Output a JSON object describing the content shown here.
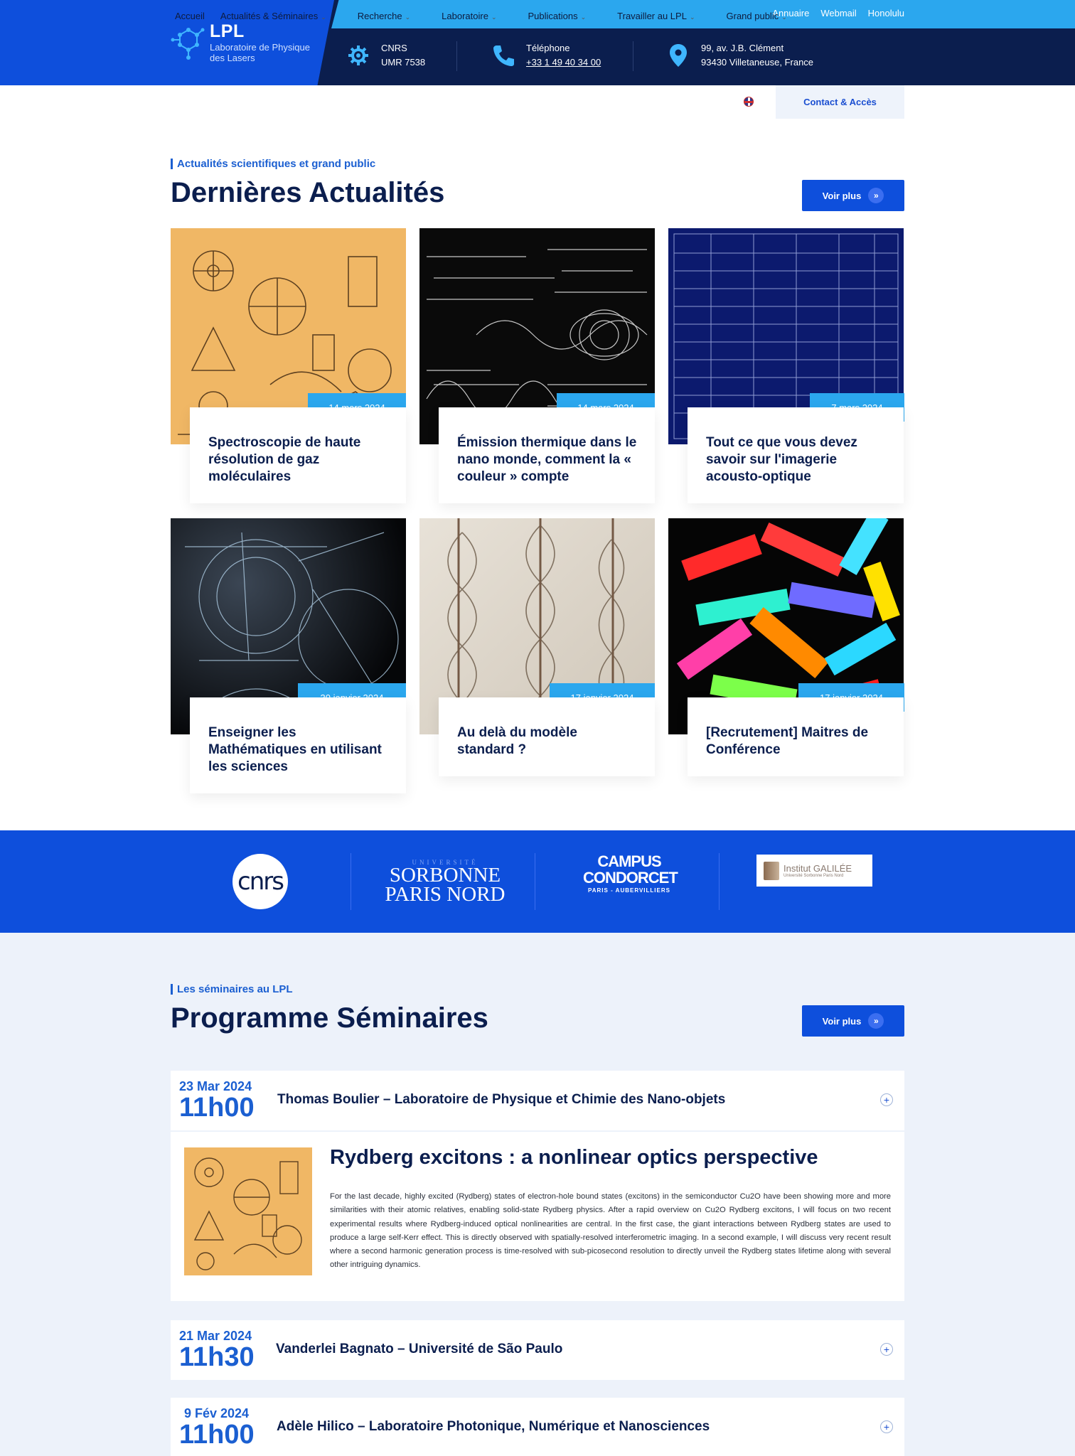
{
  "header": {
    "top_links": [
      "Annuaire",
      "Webmail",
      "Honolulu"
    ],
    "logo_title": "LPL",
    "logo_subtitle": "Laboratoire de Physique des Lasers",
    "info1_line1": "CNRS",
    "info1_line2": "UMR 7538",
    "info2_line1": "Téléphone",
    "info2_line2": "+33 1 49 40 34 00",
    "info3_line1": "99, av. J.B. Clément",
    "info3_line2": "93430 Villetaneuse, France"
  },
  "nav": {
    "items": [
      "Accueil",
      "Actualités & Séminaires",
      "Recherche",
      "Laboratoire",
      "Publications",
      "Travailler au LPL",
      "Grand public"
    ],
    "contact_label": "Contact & Accès",
    "language_icon": "uk-flag-icon"
  },
  "news": {
    "eyebrow": "Actualités scientifiques et grand public",
    "title": "Dernières Actualités",
    "more_label": "Voir plus",
    "cards": [
      {
        "date": "14 mars 2024",
        "title": "Spectroscopie de haute résolution de gaz moléculaires",
        "image": "vintage-science-sketch"
      },
      {
        "date": "14 mars 2024",
        "title": "Émission thermique dans le nano monde, comment la « couleur » compte",
        "image": "chalkboard-equations"
      },
      {
        "date": "7 mars 2024",
        "title": "Tout ce que vous devez savoir sur l'imagerie acousto-optique",
        "image": "blue-formula-grid"
      },
      {
        "date": "30 janvier 2024",
        "title": "Enseigner les Mathématiques en utilisant les sciences",
        "image": "dark-math-sketch"
      },
      {
        "date": "17 janvier 2024",
        "title": "Au delà du modèle standard ?",
        "image": "dna-helix"
      },
      {
        "date": "17 janvier 2024",
        "title": "[Recrutement] Maitres de Conférence",
        "image": "fluorescent-slides"
      }
    ]
  },
  "partners": {
    "cnrs": "cnrs",
    "sorbonne_small": "UNIVERSITÉ",
    "sorbonne_l1": "SORBONNE",
    "sorbonne_l2": "PARIS NORD",
    "campus_l1": "CAMPUS",
    "campus_l2": "CONDORCET",
    "campus_l3": "PARIS - AUBERVILLIERS",
    "galilee_l1": "Institut GALILÉE",
    "galilee_l2": "Université Sorbonne Paris Nord"
  },
  "seminars": {
    "eyebrow": "Les séminaires au LPL",
    "title": "Programme Séminaires",
    "more_label": "Voir plus",
    "items": [
      {
        "date": "23 Mar 2024",
        "time": "11h00",
        "speaker": "Thomas Boulier – Laboratoire de Physique et Chimie des Nano-objets"
      },
      {
        "date": "21 Mar 2024",
        "time": "11h30",
        "speaker": "Vanderlei Bagnato – Université de São Paulo"
      },
      {
        "date": "9 Fév 2024",
        "time": "11h00",
        "speaker": "Adèle Hilico – Laboratoire Photonique, Numérique et Nanosciences"
      }
    ],
    "expanded": {
      "title": "Rydberg excitons : a nonlinear optics perspective",
      "abstract": "For the last decade, highly excited (Rydberg) states of electron-hole bound states (excitons) in the semiconductor Cu2O have been showing more and more similarities with their atomic relatives, enabling solid-state Rydberg physics. After a rapid overview on Cu2O Rydberg excitons, I will focus on two recent experimental results where Rydberg-induced optical nonlinearities are central. In the first case, the giant interactions between Rydberg states are used to produce a large self-Kerr effect. This is directly observed with spatially-resolved interferometric imaging. In a second example, I will discuss very recent result where a second harmonic generation process is time-resolved with sub-picosecond resolution to directly unveil the Rydberg states lifetime along with several other intriguing dynamics."
    }
  },
  "colors": {
    "brand_blue": "#0e4fdc",
    "navy": "#0b1e4e",
    "accent_cyan": "#2ba7ee"
  }
}
